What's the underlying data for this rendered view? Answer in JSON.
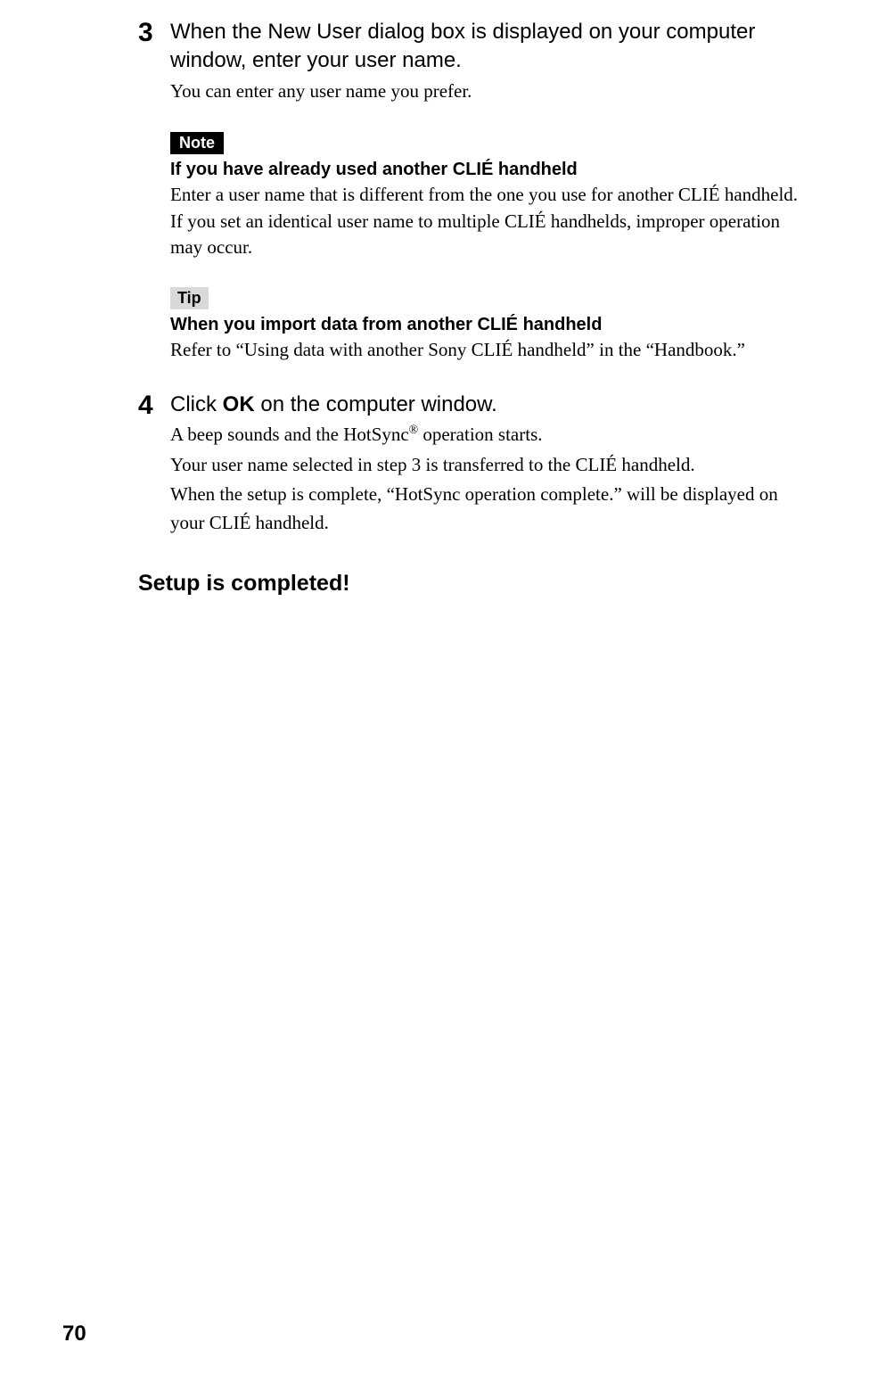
{
  "page_number": "70",
  "steps": [
    {
      "num": "3",
      "title": "When the New User dialog box is displayed on your computer window, enter your user name.",
      "desc": "You can enter any user name you prefer."
    },
    {
      "num": "4",
      "title_prefix": "Click ",
      "title_bold": "OK",
      "title_suffix": " on the computer window.",
      "desc_line1a": "A beep sounds and the HotSync",
      "desc_line1_reg": "®",
      "desc_line1b": " operation starts.",
      "desc_line2": "Your user name selected in step 3 is transferred to the CLIÉ handheld.",
      "desc_line3": "When the setup is complete, “HotSync operation complete.” will be displayed on your CLIÉ handheld."
    }
  ],
  "note_callout": {
    "label": "Note",
    "heading": "If you have already used another CLIÉ handheld",
    "text": "Enter a user name that is different from the one you use for another CLIÉ handheld. If you set an identical user name to multiple CLIÉ handhelds, improper operation may occur."
  },
  "tip_callout": {
    "label": "Tip",
    "heading": "When you import data from another CLIÉ handheld",
    "text": "Refer to “Using data with another Sony CLIÉ handheld” in the “Handbook.”"
  },
  "completed_text": "Setup is completed!"
}
